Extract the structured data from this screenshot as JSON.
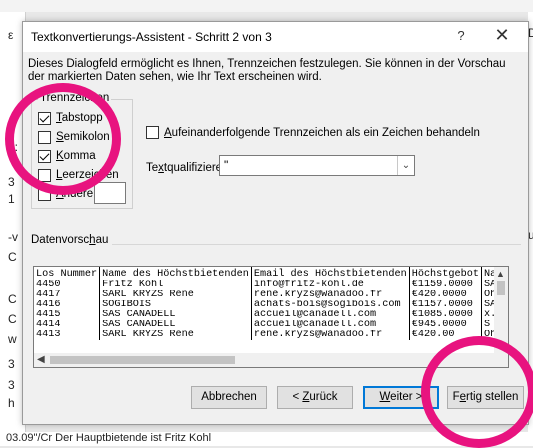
{
  "background": {
    "left_chars": [
      "ε",
      "1:",
      "3",
      "1",
      "-v",
      "C",
      "C",
      "C",
      "w",
      "3",
      "3",
      "h"
    ],
    "right_chars": [
      "D",
      "u"
    ],
    "bottom_text": "03.09\"/Cr       Der Hauptbietende ist Fritz Kohl"
  },
  "dialog": {
    "title": "Textkonvertierungs-Assistent - Schritt 2 von 3",
    "help": "?",
    "close": "✕",
    "description": "Dieses Dialogfeld ermöglicht es Ihnen, Trennzeichen festzulegen. Sie können in der Vorschau der markierten Daten sehen, wie Ihr Text erscheinen wird."
  },
  "trennzeichen": {
    "legend": "Trennzeichen",
    "options": [
      {
        "key": "T",
        "rest": "abstopp",
        "checked": true
      },
      {
        "key": "S",
        "rest": "emikolon",
        "checked": false
      },
      {
        "key": "K",
        "rest": "omma",
        "checked": true
      },
      {
        "key": "L",
        "rest": "eerzeichen",
        "checked": false
      },
      {
        "key": "A",
        "rest": "ndere:",
        "checked": false
      }
    ]
  },
  "aufeinanderfolgende": {
    "pre": "A",
    "rest": "ufeinanderfolgende Trennzeichen als ein Zeichen behandeln",
    "checked": false
  },
  "textqualifizierer": {
    "label_pre": "Te",
    "label_key": "x",
    "label_rest": "tqualifizierer:",
    "value": "\""
  },
  "preview": {
    "label_pre": "Datenvorsc",
    "label_key": "h",
    "label_rest": "au",
    "rows": [
      [
        "Los Nummer",
        "Name des Höchstbietenden",
        "Email des Höchstbietenden",
        "Höchstgebot",
        "Na"
      ],
      [
        "4450",
        "Fritz Kohl",
        "info@fritz-kohl.de",
        "€1159.0000",
        "SA"
      ],
      [
        "4417",
        "SARL KRYZS Rene",
        "rene.kryzs@wanadoo.fr",
        "€420.0000",
        "Oh"
      ],
      [
        "4416",
        "SOGIBOIS",
        "achats-bois@sogibois.com",
        "€1157.0000",
        "SA"
      ],
      [
        "4415",
        "SAS CANADELL",
        "accueil@canadell.com",
        "€1085.0000",
        "x.1"
      ],
      [
        "4414",
        "SAS CANADELL",
        "accueil@canadell.com",
        "€945.0000",
        "S"
      ],
      [
        "4413",
        "SARL KRYZS Rene",
        "rene.kryzs@wanadoo.fr",
        "€420.00",
        "Oh"
      ]
    ]
  },
  "buttons": {
    "cancel": "Abbrechen",
    "back_key": "Z",
    "back_rest": "urück",
    "back_prefix": "< ",
    "next_key": "W",
    "next_rest": "eiter >",
    "finish_pre": "F",
    "finish_key": "e",
    "finish_rest": "rtig stellen"
  },
  "colors": {
    "annotation_ring": "#e8137f",
    "primary_border": "#0078d7"
  }
}
